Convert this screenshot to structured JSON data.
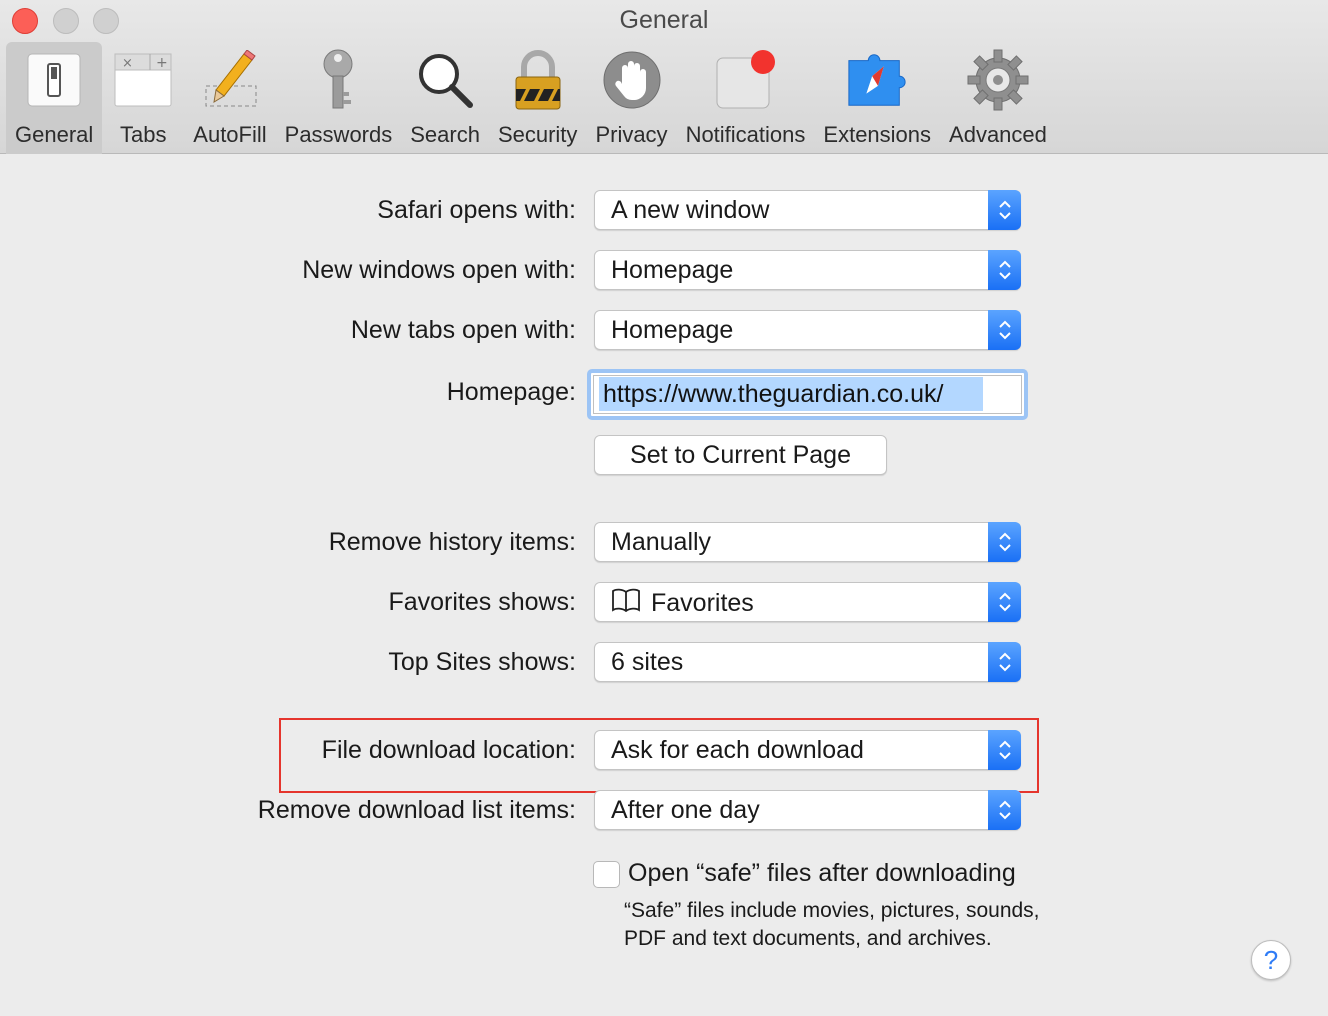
{
  "window": {
    "title": "General"
  },
  "toolbar": {
    "items": [
      {
        "label": "General",
        "icon": "general-switch-icon",
        "selected": true
      },
      {
        "label": "Tabs",
        "icon": "tabs-icon"
      },
      {
        "label": "AutoFill",
        "icon": "pencil-icon"
      },
      {
        "label": "Passwords",
        "icon": "key-icon"
      },
      {
        "label": "Search",
        "icon": "magnifier-icon"
      },
      {
        "label": "Security",
        "icon": "padlock-icon"
      },
      {
        "label": "Privacy",
        "icon": "hand-icon"
      },
      {
        "label": "Notifications",
        "icon": "notification-badge-icon"
      },
      {
        "label": "Extensions",
        "icon": "compass-puzzle-icon"
      },
      {
        "label": "Advanced",
        "icon": "gear-icon"
      }
    ]
  },
  "settings": {
    "safari_opens_with": {
      "label": "Safari opens with:",
      "value": "A new window"
    },
    "new_windows_open_with": {
      "label": "New windows open with:",
      "value": "Homepage"
    },
    "new_tabs_open_with": {
      "label": "New tabs open with:",
      "value": "Homepage"
    },
    "homepage": {
      "label": "Homepage:",
      "value": "https://www.theguardian.co.uk/"
    },
    "set_current_page_button": "Set to Current Page",
    "remove_history_items": {
      "label": "Remove history items:",
      "value": "Manually"
    },
    "favorites_shows": {
      "label": "Favorites shows:",
      "value": "Favorites"
    },
    "top_sites_shows": {
      "label": "Top Sites shows:",
      "value": "6 sites"
    },
    "file_download_location": {
      "label": "File download location:",
      "value": "Ask for each download"
    },
    "remove_download_list_items": {
      "label": "Remove download list items:",
      "value": "After one day"
    },
    "open_safe_files": {
      "label": "Open “safe” files after downloading",
      "checked": false,
      "hint": "“Safe” files include movies, pictures, sounds, PDF and text documents, and archives."
    }
  },
  "help_button": "?",
  "colors": {
    "accent": "#1a70f5",
    "highlight_box": "#e5352d",
    "close": "#fc5f57"
  }
}
